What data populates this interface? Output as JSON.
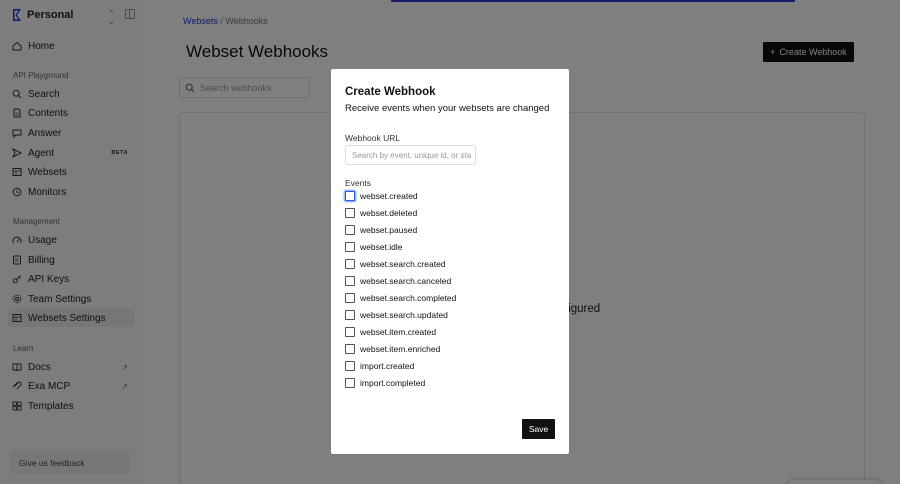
{
  "sidebar": {
    "workspace": "Personal",
    "items": [
      {
        "label": "Home",
        "icon": "home-icon"
      },
      {
        "label": "Search",
        "icon": "search-icon"
      },
      {
        "label": "Contents",
        "icon": "document-icon"
      },
      {
        "label": "Answer",
        "icon": "chat-icon"
      },
      {
        "label": "Agent",
        "icon": "agent-icon",
        "badge": "BETA"
      },
      {
        "label": "Websets",
        "icon": "table-icon"
      },
      {
        "label": "Monitors",
        "icon": "clock-icon"
      },
      {
        "label": "Usage",
        "icon": "usage-icon"
      },
      {
        "label": "Billing",
        "icon": "card-icon"
      },
      {
        "label": "API Keys",
        "icon": "key-icon"
      },
      {
        "label": "Team Settings",
        "icon": "settings-icon"
      },
      {
        "label": "Websets Settings",
        "icon": "table-icon"
      },
      {
        "label": "Docs",
        "icon": "book-icon"
      },
      {
        "label": "Exa MCP",
        "icon": "mcp-icon"
      },
      {
        "label": "Templates",
        "icon": "templates-icon"
      }
    ],
    "sections": {
      "api_playground": "API Playground",
      "management": "Management",
      "learn": "Learn"
    },
    "feedback": "Give us feedback"
  },
  "main": {
    "breadcrumb_link": "Websets",
    "breadcrumb_sep": "/",
    "breadcrumb_current": "Webhooks",
    "title": "Webset Webhooks",
    "create_button": "Create Webhook",
    "search_placeholder": "Search webhooks",
    "empty_text": "figured"
  },
  "modal": {
    "title": "Create Webhook",
    "subtitle": "Receive events when your websets are changed",
    "url_label": "Webhook URL",
    "url_placeholder": "Search by event, unique id, or sta",
    "events_label": "Events",
    "events": [
      "webset.created",
      "webset.deleted",
      "webset.paused",
      "webset.idle",
      "webset.search.created",
      "webset.search.canceled",
      "webset.search.completed",
      "webset.search.updated",
      "webset.item.created",
      "webset.item.enriched",
      "import.created",
      "import.completed"
    ],
    "save": "Save"
  },
  "colors": {
    "accent": "#1f3bd1",
    "primary_button": "#111111",
    "overlay": "rgba(0,0,0,0.5)"
  }
}
